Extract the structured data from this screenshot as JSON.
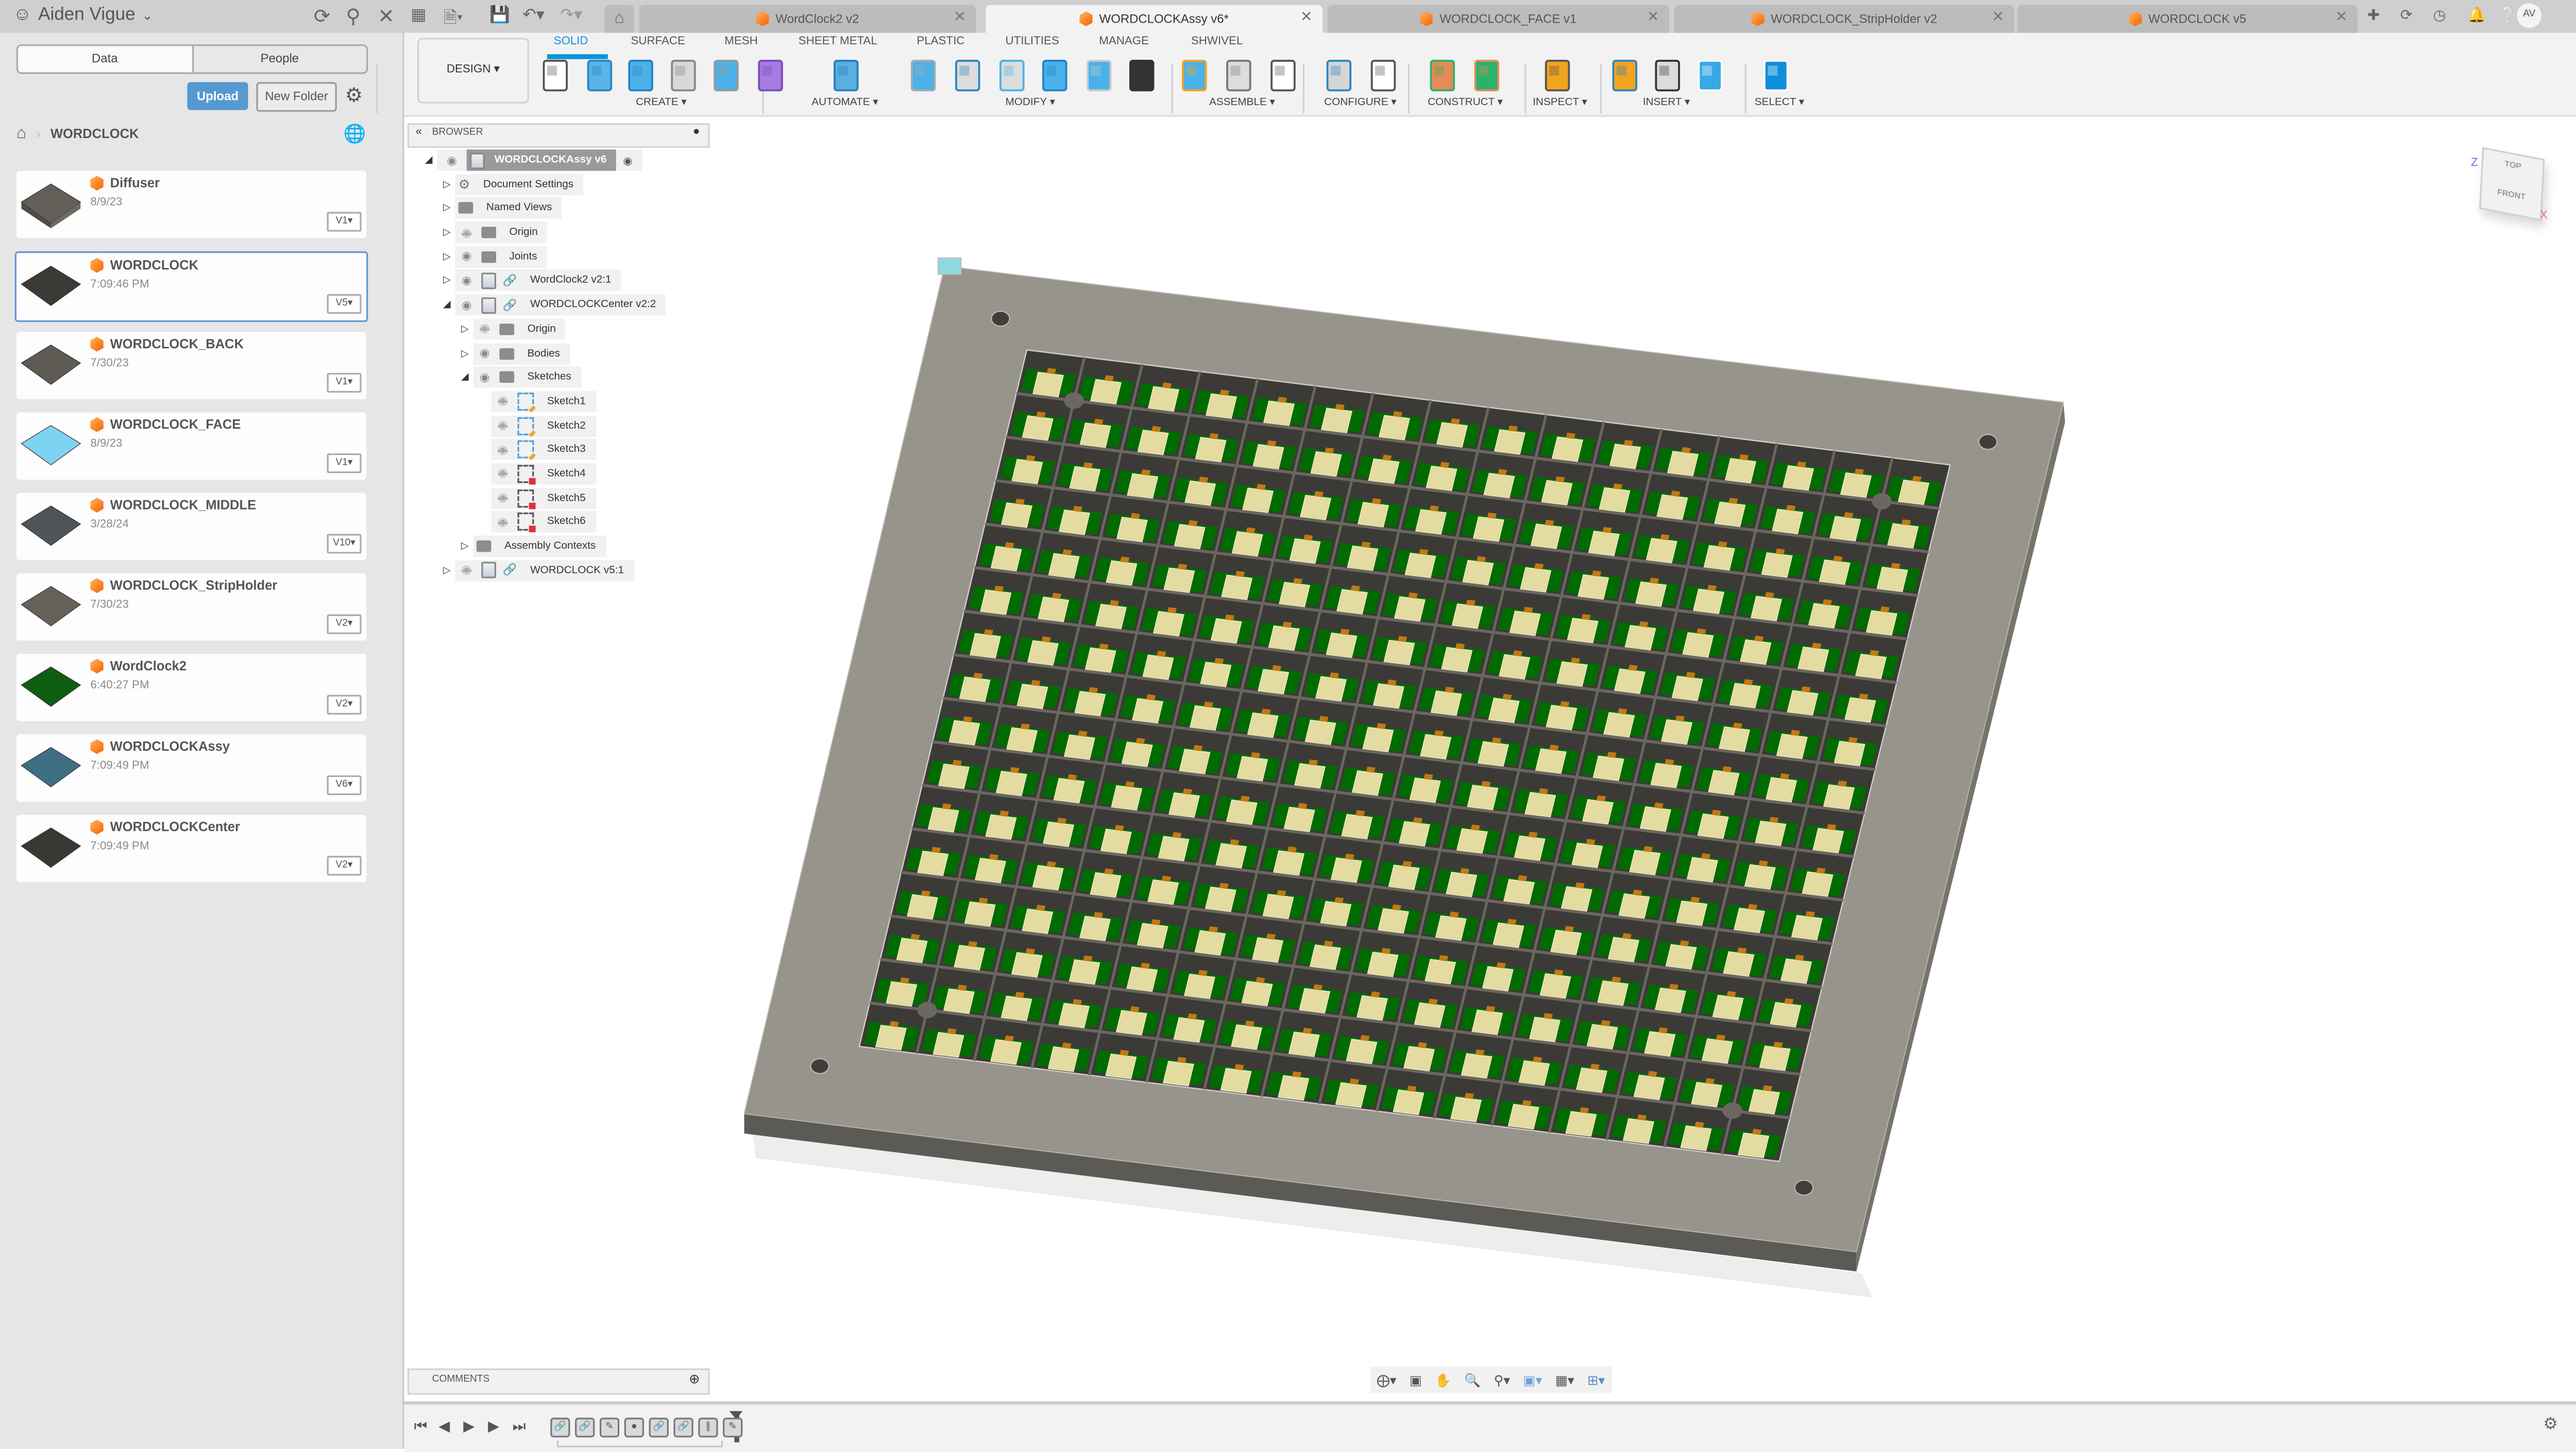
{
  "data_panel": {
    "user_name": "Aiden Vigue",
    "tabs": [
      {
        "label": "Data",
        "active": true
      },
      {
        "label": "People",
        "active": false
      }
    ],
    "upload_label": "Upload",
    "new_folder_label": "New Folder",
    "breadcrumb": {
      "folder": "WORDCLOCK"
    },
    "files": [
      {
        "name": "Diffuser",
        "date": "8/9/23",
        "version": "V1",
        "thumb": "box"
      },
      {
        "name": "WORDCLOCK",
        "date": "7:09:46 PM",
        "version": "V5",
        "thumb": "grid-dark",
        "selected": true
      },
      {
        "name": "WORDCLOCK_BACK",
        "date": "7/30/23",
        "version": "V1",
        "thumb": "plate"
      },
      {
        "name": "WORDCLOCK_FACE",
        "date": "8/9/23",
        "version": "V1",
        "thumb": "face-blue"
      },
      {
        "name": "WORDCLOCK_MIDDLE",
        "date": "3/28/24",
        "version": "V10",
        "thumb": "middle"
      },
      {
        "name": "WORDCLOCK_StripHolder",
        "date": "7/30/23",
        "version": "V2",
        "thumb": "strip"
      },
      {
        "name": "WordClock2",
        "date": "6:40:27 PM",
        "version": "V2",
        "thumb": "green"
      },
      {
        "name": "WORDCLOCKAssy",
        "date": "7:09:49 PM",
        "version": "V6",
        "thumb": "assy"
      },
      {
        "name": "WORDCLOCKCenter",
        "date": "7:09:49 PM",
        "version": "V2",
        "thumb": "center"
      }
    ]
  },
  "tabs": [
    {
      "label": "WordClock2 v2",
      "active": false
    },
    {
      "label": "WORDCLOCKAssy v6*",
      "active": true
    },
    {
      "label": "WORDCLOCK_FACE v1",
      "active": false
    },
    {
      "label": "WORDCLOCK_StripHolder v2",
      "active": false
    },
    {
      "label": "WORDCLOCK v5",
      "active": false
    }
  ],
  "user_initials": "AV",
  "toolbar": {
    "workspace": "DESIGN",
    "tabs": [
      "SOLID",
      "SURFACE",
      "MESH",
      "SHEET METAL",
      "PLASTIC",
      "UTILITIES",
      "MANAGE",
      "SHWIVEL"
    ],
    "active_tab": "SOLID",
    "groups": [
      "CREATE",
      "AUTOMATE",
      "MODIFY",
      "ASSEMBLE",
      "CONFIGURE",
      "CONSTRUCT",
      "INSPECT",
      "INSERT",
      "SELECT"
    ]
  },
  "browser": {
    "title": "BROWSER",
    "root": "WORDCLOCKAssy v6",
    "items": [
      {
        "label": "Document Settings",
        "icon": "gear",
        "level": 1,
        "expand": "collapsed"
      },
      {
        "label": "Named Views",
        "icon": "folder",
        "level": 1,
        "expand": "collapsed"
      },
      {
        "label": "Origin",
        "icon": "folder",
        "level": 1,
        "expand": "collapsed",
        "visible": false
      },
      {
        "label": "Joints",
        "icon": "folder",
        "level": 1,
        "expand": "collapsed",
        "visible": true
      },
      {
        "label": "WordClock2 v2:1",
        "icon": "component-link",
        "level": 1,
        "expand": "collapsed",
        "visible": true
      },
      {
        "label": "WORDCLOCKCenter v2:2",
        "icon": "body-link",
        "level": 1,
        "expand": "expanded",
        "visible": true
      },
      {
        "label": "Origin",
        "icon": "folder",
        "level": 2,
        "expand": "collapsed",
        "visible": false
      },
      {
        "label": "Bodies",
        "icon": "folder",
        "level": 2,
        "expand": "collapsed",
        "visible": true
      },
      {
        "label": "Sketches",
        "icon": "folder",
        "level": 2,
        "expand": "expanded",
        "visible": true
      },
      {
        "label": "Sketch1",
        "icon": "sketch-edit",
        "level": 3,
        "visible": false
      },
      {
        "label": "Sketch2",
        "icon": "sketch-edit",
        "level": 3,
        "visible": false
      },
      {
        "label": "Sketch3",
        "icon": "sketch-edit",
        "level": 3,
        "visible": false
      },
      {
        "label": "Sketch4",
        "icon": "sketch-locked",
        "level": 3,
        "visible": false
      },
      {
        "label": "Sketch5",
        "icon": "sketch-locked",
        "level": 3,
        "visible": false
      },
      {
        "label": "Sketch6",
        "icon": "sketch-locked",
        "level": 3,
        "visible": false
      },
      {
        "label": "Assembly Contexts",
        "icon": "folder",
        "level": 2,
        "expand": "collapsed"
      },
      {
        "label": "WORDCLOCK v5:1",
        "icon": "component-link",
        "level": 1,
        "expand": "collapsed",
        "visible": false
      }
    ]
  },
  "comments": {
    "title": "COMMENTS"
  },
  "viewcube": {
    "top": "TOP",
    "front": "FRONT",
    "axis_z": "Z",
    "axis_x": "X"
  },
  "model": {
    "grid_rows": 16,
    "grid_cols": 16,
    "colors": {
      "frame": "#97948c",
      "edge": "#5b5a55",
      "pcb": "#006b00",
      "cell_wall": "#3b3a37",
      "led": "#e4dba0"
    }
  },
  "timeline": {
    "feature_count": 8
  }
}
